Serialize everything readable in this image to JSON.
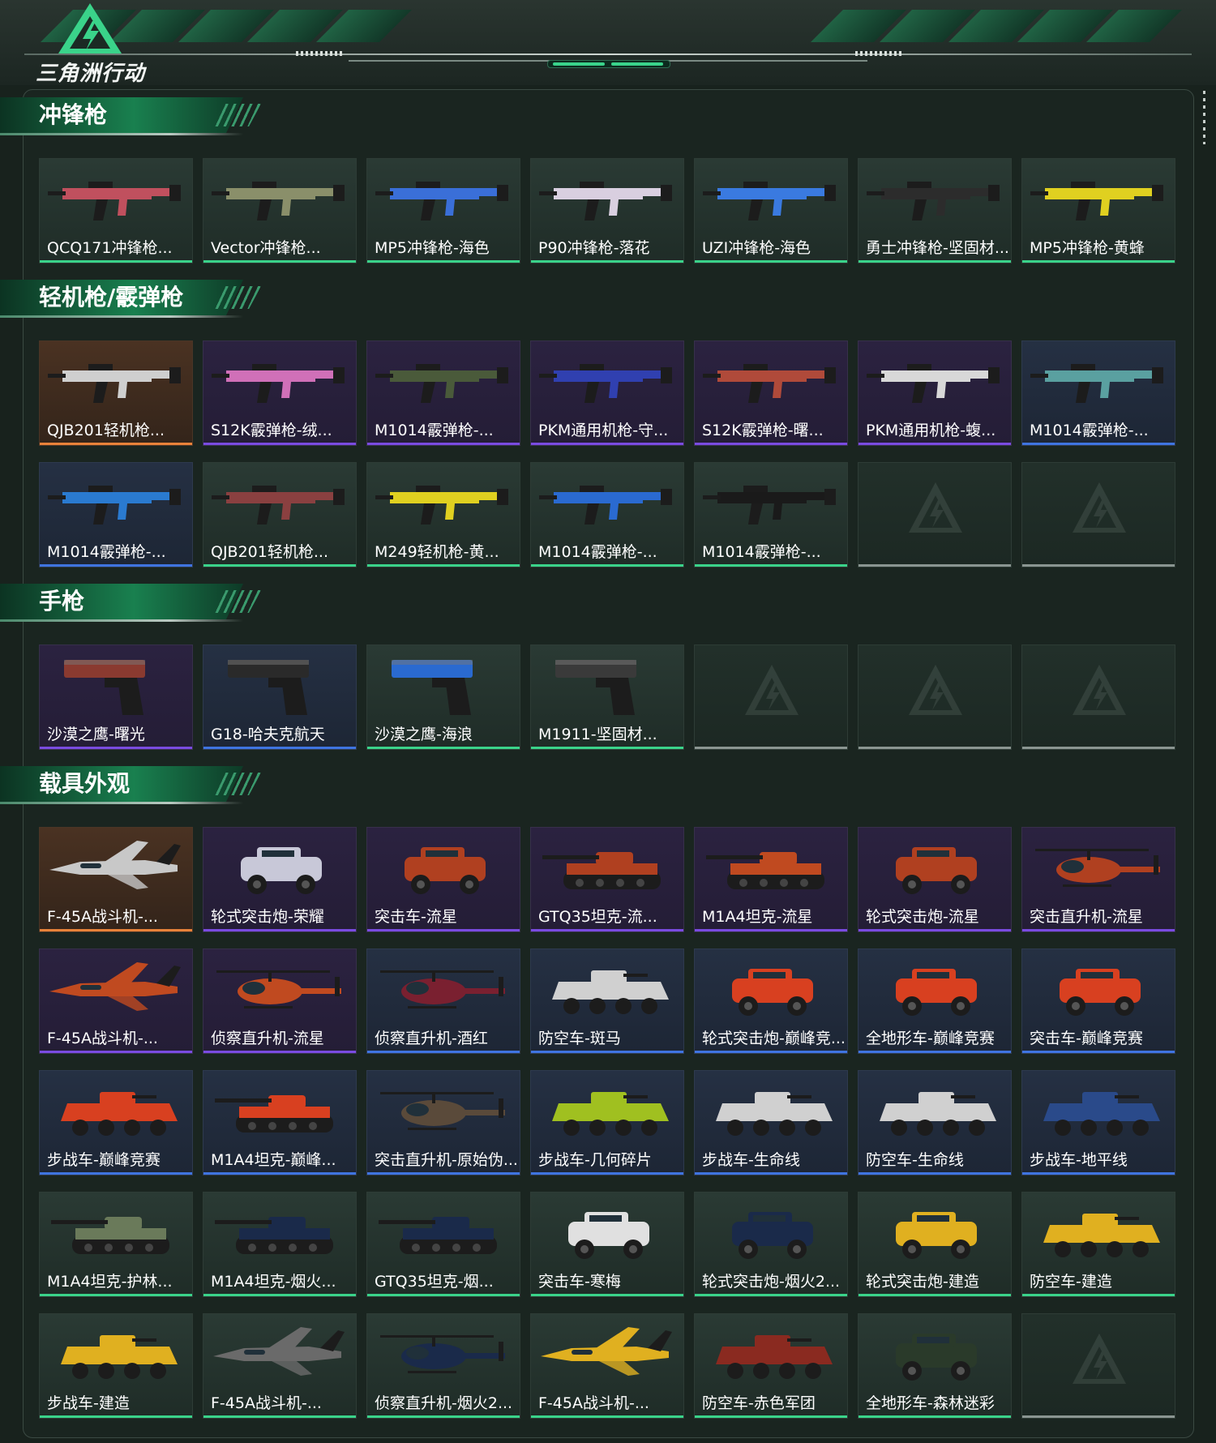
{
  "logo_text": "三角洲行动",
  "colors": {
    "accent": "#3ad38a",
    "rarity_green": "#3ad38a",
    "rarity_purple": "#7a4be0",
    "rarity_orange": "#e8823a",
    "rarity_blue": "#3f74e0"
  },
  "sections": [
    {
      "title": "冲锋枪",
      "rows": [
        [
          {
            "label": "QCQ171冲锋枪...",
            "rarity": "green",
            "kind": "gun",
            "tint": "#c0505e"
          },
          {
            "label": "Vector冲锋枪...",
            "rarity": "green",
            "kind": "gun",
            "tint": "#8a8f6a"
          },
          {
            "label": "MP5冲锋枪-海色",
            "rarity": "green",
            "kind": "gun",
            "tint": "#3a6fd8"
          },
          {
            "label": "P90冲锋枪-落花",
            "rarity": "green",
            "kind": "gun",
            "tint": "#d9cfe0"
          },
          {
            "label": "UZI冲锋枪-海色",
            "rarity": "green",
            "kind": "gun",
            "tint": "#3a7ae0"
          },
          {
            "label": "勇士冲锋枪-坚固材...",
            "rarity": "green",
            "kind": "gun",
            "tint": "#2c2c2c"
          },
          {
            "label": "MP5冲锋枪-黄蜂",
            "rarity": "green",
            "kind": "gun",
            "tint": "#e0d020"
          }
        ]
      ]
    },
    {
      "title": "轻机枪/霰弹枪",
      "rows": [
        [
          {
            "label": "QJB201轻机枪...",
            "rarity": "orange",
            "kind": "gun",
            "tint": "#cfcfcf"
          },
          {
            "label": "S12K霰弹枪-绒...",
            "rarity": "purple",
            "kind": "gun",
            "tint": "#d070b8"
          },
          {
            "label": "M1014霰弹枪-...",
            "rarity": "purple",
            "kind": "gun",
            "tint": "#4a5a3a"
          },
          {
            "label": "PKM通用机枪-守...",
            "rarity": "purple",
            "kind": "gun",
            "tint": "#3040b0"
          },
          {
            "label": "S12K霰弹枪-曙...",
            "rarity": "purple",
            "kind": "gun",
            "tint": "#b04a3a"
          },
          {
            "label": "PKM通用机枪-蝮...",
            "rarity": "purple",
            "kind": "gun",
            "tint": "#d8d8d8"
          },
          {
            "label": "M1014霰弹枪-...",
            "rarity": "blue",
            "kind": "gun",
            "tint": "#5aa0a0"
          }
        ],
        [
          {
            "label": "M1014霰弹枪-...",
            "rarity": "blue",
            "kind": "gun",
            "tint": "#2a7ad0"
          },
          {
            "label": "QJB201轻机枪...",
            "rarity": "green",
            "kind": "gun",
            "tint": "#8a4040"
          },
          {
            "label": "M249轻机枪-黄...",
            "rarity": "green",
            "kind": "gun",
            "tint": "#e0d020"
          },
          {
            "label": "M1014霰弹枪-...",
            "rarity": "green",
            "kind": "gun",
            "tint": "#2a6ad0"
          },
          {
            "label": "M1014霰弹枪-...",
            "rarity": "green",
            "kind": "gun",
            "tint": "#1a1a1a"
          },
          {
            "label": "",
            "rarity": "empty",
            "kind": "empty"
          },
          {
            "label": "",
            "rarity": "empty",
            "kind": "empty"
          }
        ]
      ]
    },
    {
      "title": "手枪",
      "rows": [
        [
          {
            "label": "沙漠之鹰-曙光",
            "rarity": "purple",
            "kind": "pistol",
            "tint": "#8a3a30"
          },
          {
            "label": "G18-哈夫克航天",
            "rarity": "blue",
            "kind": "pistol",
            "tint": "#2a2a2a"
          },
          {
            "label": "沙漠之鹰-海浪",
            "rarity": "green",
            "kind": "pistol",
            "tint": "#2a6ad0"
          },
          {
            "label": "M1911-坚固材...",
            "rarity": "green",
            "kind": "pistol",
            "tint": "#3a3a3a"
          },
          {
            "label": "",
            "rarity": "empty",
            "kind": "empty"
          },
          {
            "label": "",
            "rarity": "empty",
            "kind": "empty"
          },
          {
            "label": "",
            "rarity": "empty",
            "kind": "empty"
          }
        ]
      ]
    },
    {
      "title": "载具外观",
      "rows": [
        [
          {
            "label": "F-45A战斗机-...",
            "rarity": "orange",
            "kind": "jet",
            "tint": "#c8c8c8"
          },
          {
            "label": "轮式突击炮-荣耀",
            "rarity": "purple",
            "kind": "car",
            "tint": "#c8c8d8"
          },
          {
            "label": "突击车-流星",
            "rarity": "purple",
            "kind": "car",
            "tint": "#b04020"
          },
          {
            "label": "GTQ35坦克-流...",
            "rarity": "purple",
            "kind": "tank",
            "tint": "#b04020"
          },
          {
            "label": "M1A4坦克-流星",
            "rarity": "purple",
            "kind": "tank",
            "tint": "#c04a20"
          },
          {
            "label": "轮式突击炮-流星",
            "rarity": "purple",
            "kind": "car",
            "tint": "#b04020"
          },
          {
            "label": "突击直升机-流星",
            "rarity": "purple",
            "kind": "heli",
            "tint": "#b04020"
          }
        ],
        [
          {
            "label": "F-45A战斗机-...",
            "rarity": "purple",
            "kind": "jet",
            "tint": "#c04a20"
          },
          {
            "label": "侦察直升机-流星",
            "rarity": "purple",
            "kind": "heli",
            "tint": "#c04a20"
          },
          {
            "label": "侦察直升机-酒红",
            "rarity": "blue",
            "kind": "heli",
            "tint": "#7a2030"
          },
          {
            "label": "防空车-斑马",
            "rarity": "blue",
            "kind": "apc",
            "tint": "#d0d0d0"
          },
          {
            "label": "轮式突击炮-巅峰竞...",
            "rarity": "blue",
            "kind": "car",
            "tint": "#d84020"
          },
          {
            "label": "全地形车-巅峰竞赛",
            "rarity": "blue",
            "kind": "car",
            "tint": "#d84020"
          },
          {
            "label": "突击车-巅峰竞赛",
            "rarity": "blue",
            "kind": "car",
            "tint": "#d84020"
          }
        ],
        [
          {
            "label": "步战车-巅峰竞赛",
            "rarity": "blue",
            "kind": "apc",
            "tint": "#d84020"
          },
          {
            "label": "M1A4坦克-巅峰...",
            "rarity": "blue",
            "kind": "tank",
            "tint": "#d84020"
          },
          {
            "label": "突击直升机-原始伪...",
            "rarity": "blue",
            "kind": "heli",
            "tint": "#5a4a3a"
          },
          {
            "label": "步战车-几何碎片",
            "rarity": "blue",
            "kind": "apc",
            "tint": "#a0c020"
          },
          {
            "label": "步战车-生命线",
            "rarity": "blue",
            "kind": "apc",
            "tint": "#d0d0d0"
          },
          {
            "label": "防空车-生命线",
            "rarity": "blue",
            "kind": "apc",
            "tint": "#d0d0d0"
          },
          {
            "label": "步战车-地平线",
            "rarity": "blue",
            "kind": "apc",
            "tint": "#2a4a8a"
          }
        ],
        [
          {
            "label": "M1A4坦克-护林...",
            "rarity": "green",
            "kind": "tank",
            "tint": "#6a7a5a"
          },
          {
            "label": "M1A4坦克-烟火...",
            "rarity": "green",
            "kind": "tank",
            "tint": "#1a2a4a"
          },
          {
            "label": "GTQ35坦克-烟...",
            "rarity": "green",
            "kind": "tank",
            "tint": "#1a2a4a"
          },
          {
            "label": "突击车-寒梅",
            "rarity": "green",
            "kind": "car",
            "tint": "#e0e0e0"
          },
          {
            "label": "轮式突击炮-烟火2...",
            "rarity": "green",
            "kind": "car",
            "tint": "#1a2a4a"
          },
          {
            "label": "轮式突击炮-建造",
            "rarity": "green",
            "kind": "car",
            "tint": "#e0b020"
          },
          {
            "label": "防空车-建造",
            "rarity": "green",
            "kind": "apc",
            "tint": "#e0b020"
          }
        ],
        [
          {
            "label": "步战车-建造",
            "rarity": "green",
            "kind": "apc",
            "tint": "#e0b020"
          },
          {
            "label": "F-45A战斗机-...",
            "rarity": "green",
            "kind": "jet",
            "tint": "#6a6a6a"
          },
          {
            "label": "侦察直升机-烟火2...",
            "rarity": "green",
            "kind": "heli",
            "tint": "#1a2a4a"
          },
          {
            "label": "F-45A战斗机-...",
            "rarity": "green",
            "kind": "jet",
            "tint": "#e0b020"
          },
          {
            "label": "防空车-赤色军团",
            "rarity": "green",
            "kind": "apc",
            "tint": "#8a2a20"
          },
          {
            "label": "全地形车-森林迷彩",
            "rarity": "green",
            "kind": "car",
            "tint": "#2a3a2a"
          },
          {
            "label": "",
            "rarity": "empty",
            "kind": "empty"
          }
        ]
      ]
    }
  ]
}
